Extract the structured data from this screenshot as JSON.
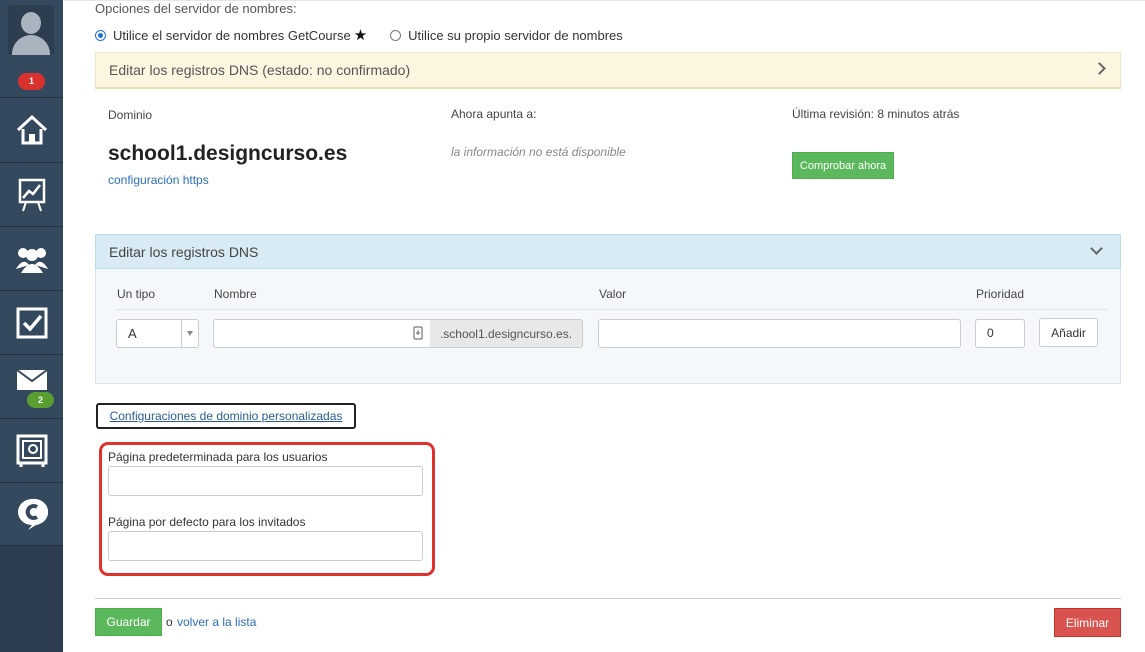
{
  "sidebar": {
    "notifications_badge": "1",
    "mail_badge": "2",
    "items": [
      "home",
      "statistics",
      "users",
      "tasks",
      "messages",
      "safe",
      "chat"
    ]
  },
  "nameserver": {
    "title": "Opciones del servidor de nombres:",
    "option_getcourse": "Utilice el servidor de nombres GetCourse",
    "option_own": "Utilice su propio servidor de nombres",
    "selected": "getcourse"
  },
  "dns_status_panel": {
    "title": "Editar los registros DNS (estado: no confirmado)"
  },
  "domain_info": {
    "domain_label": "Dominio",
    "domain_value": "school1.designcurso.es",
    "https_link": "configuración https",
    "points_label": "Ahora apunta a:",
    "points_value": "la información no está disponible",
    "revision_label": "Última revisión: 8 minutos atrás",
    "check_button": "Comprobar ahora"
  },
  "dns_edit_panel": {
    "title": "Editar los registros DNS",
    "columns": {
      "type": "Un tipo",
      "name": "Nombre",
      "value": "Valor",
      "priority": "Prioridad"
    },
    "row": {
      "type_value": "A",
      "name_value": "",
      "domain_suffix": ".school1.designcurso.es.",
      "value_value": "",
      "priority_value": "0",
      "add_button": "Añadir"
    }
  },
  "custom_settings": {
    "link": "Configuraciones de dominio personalizadas",
    "default_user_page_label": "Página predeterminada para los usuarios",
    "default_user_page_value": "",
    "default_guest_page_label": "Página por defecto para los invitados",
    "default_guest_page_value": ""
  },
  "footer": {
    "save_button": "Guardar",
    "or_text": "o",
    "back_link": "volver a la lista",
    "delete_button": "Eliminar"
  },
  "colors": {
    "sidebar": "#34495e",
    "success": "#5cb85c",
    "danger": "#d9534f",
    "highlight": "#e0312d",
    "link": "#2a6ebb"
  }
}
